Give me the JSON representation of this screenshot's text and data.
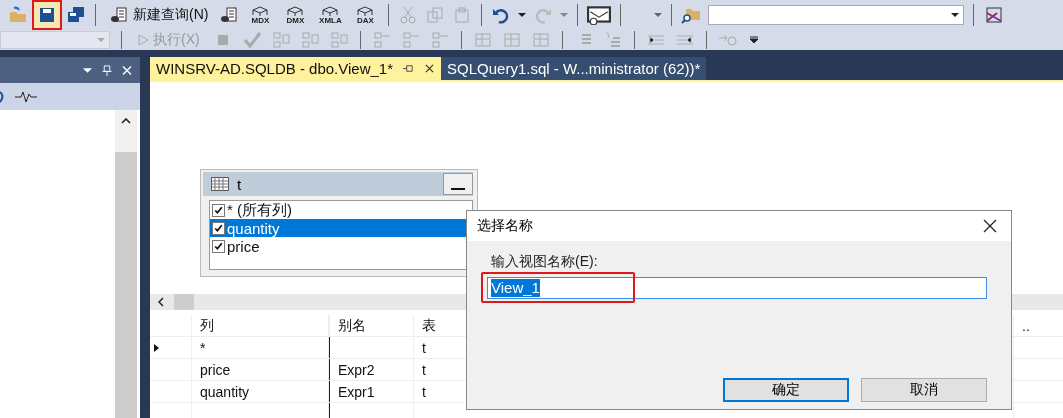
{
  "toolbar_main": {
    "save_button": {
      "annotated": true
    },
    "new_query_button": {
      "label": "新建查询(N)"
    },
    "query_buttons": [
      {
        "label": "MDX"
      },
      {
        "label": "DMX"
      },
      {
        "label": "XMLA"
      },
      {
        "label": "DAX"
      }
    ]
  },
  "toolbar_sql": {
    "execute_button": {
      "label": "执行(X)",
      "disabled": true
    }
  },
  "tabs": [
    {
      "label": "WINSRV-AD.SQLDB - dbo.View_1*",
      "selected": true
    },
    {
      "label": "SQLQuery1.sql - W...ministrator (62))*",
      "selected": false
    }
  ],
  "table_box": {
    "title": "t",
    "columns": [
      {
        "label": "* (所有列)",
        "checked": true,
        "selected": false
      },
      {
        "label": "quantity",
        "checked": true,
        "selected": true
      },
      {
        "label": "price",
        "checked": true,
        "selected": false
      }
    ]
  },
  "grid": {
    "headers": [
      "列",
      "别名",
      "表",
      ".."
    ],
    "rows": [
      {
        "current": true,
        "column": "*",
        "alias": "",
        "table": "t"
      },
      {
        "current": false,
        "column": "price",
        "alias": "Expr2",
        "table": "t"
      },
      {
        "current": false,
        "column": "quantity",
        "alias": "Expr1",
        "table": "t"
      }
    ]
  },
  "dialog": {
    "title": "选择名称",
    "label": "输入视图名称(E):",
    "value": "View_1",
    "annotated": true,
    "buttons": [
      {
        "label": "确定",
        "default": true
      },
      {
        "label": "取消",
        "default": false
      }
    ]
  }
}
